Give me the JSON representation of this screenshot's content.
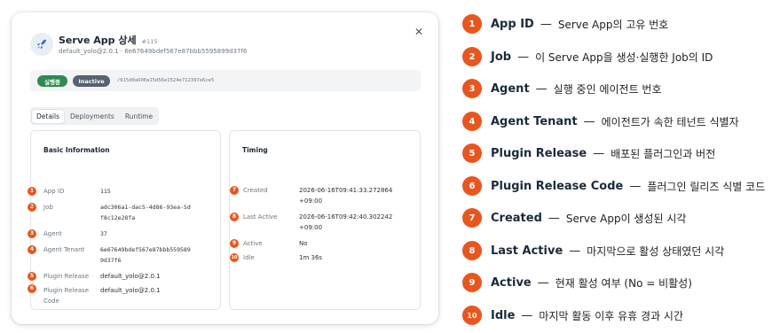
{
  "dialog": {
    "title": "Serve App 상세",
    "title_id": "#115",
    "subtitle": "default_yolo@2.0.1 · 6e67649bdef567e87bbb5595899d37f6",
    "status": {
      "running_badge": "실행중",
      "inactive_badge": "Inactive",
      "path": "/615d0a600a15d56e1524e712397e6ce5"
    },
    "tabs": [
      "Details",
      "Deployments",
      "Runtime"
    ],
    "active_tab": "Details",
    "basic": {
      "title": "Basic Information",
      "rows": [
        {
          "num": "1",
          "label": "App ID",
          "value": "115"
        },
        {
          "num": "2",
          "label": "Job",
          "value": "adc306a1-dac5-4d86-93ea-5d",
          "value2": "f8c12e28fa"
        },
        {
          "num": "3",
          "label": "Agent",
          "value": "37"
        },
        {
          "num": "4",
          "label": "Agent Tenant",
          "value": "6e67649bdef567e87bbb559589",
          "value2": "9d37f6"
        },
        {
          "num": "5",
          "label": "Plugin Release",
          "value": "default_yolo@2.0.1"
        },
        {
          "num": "6",
          "label": "Plugin Release",
          "label2": "Code",
          "value": "default_yolo@2.0.1"
        }
      ]
    },
    "timing": {
      "title": "Timing",
      "rows": [
        {
          "num": "7",
          "label": "Created",
          "value": "2026-06-16T09:41:33.272864",
          "value2": "+09:00"
        },
        {
          "num": "8",
          "label": "Last Active",
          "value": "2026-06-16T09:42:40.302242",
          "value2": "+09:00"
        },
        {
          "num": "9",
          "label": "Active",
          "value": "No"
        },
        {
          "num": "10",
          "label": "Idle",
          "value": "1m 36s"
        }
      ]
    }
  },
  "legend": [
    {
      "num": "1",
      "term": "App ID",
      "sep": "—",
      "desc": "Serve App의 고유 번호"
    },
    {
      "num": "2",
      "term": "Job",
      "sep": "—",
      "desc": "이 Serve App을 생성·실행한 Job의 ID"
    },
    {
      "num": "3",
      "term": "Agent",
      "sep": "—",
      "desc": "실행 중인 에이전트 번호"
    },
    {
      "num": "4",
      "term": "Agent Tenant",
      "sep": "—",
      "desc": "에이전트가 속한 테넌트 식별자"
    },
    {
      "num": "5",
      "term": "Plugin Release",
      "sep": "—",
      "desc": "배포된 플러그인과 버전"
    },
    {
      "num": "6",
      "term": "Plugin Release Code",
      "sep": "—",
      "desc": "플러그인 릴리즈 식별 코드"
    },
    {
      "num": "7",
      "term": "Created",
      "sep": "—",
      "desc": "Serve App이 생성된 시각"
    },
    {
      "num": "8",
      "term": "Last Active",
      "sep": "—",
      "desc": "마지막으로 활성 상태였던 시각"
    },
    {
      "num": "9",
      "term": "Active",
      "sep": "—",
      "desc": "현재 활성 여부 (No = 비활성)"
    },
    {
      "num": "10",
      "term": "Idle",
      "sep": "—",
      "desc": "마지막 활동 이후 유휴 경과 시간"
    }
  ],
  "colors": {
    "marker": "#e8561f",
    "running": "#2e8a4f",
    "inactive": "#556271"
  },
  "icons": {
    "app": "rocket-icon",
    "close": "close-icon"
  }
}
